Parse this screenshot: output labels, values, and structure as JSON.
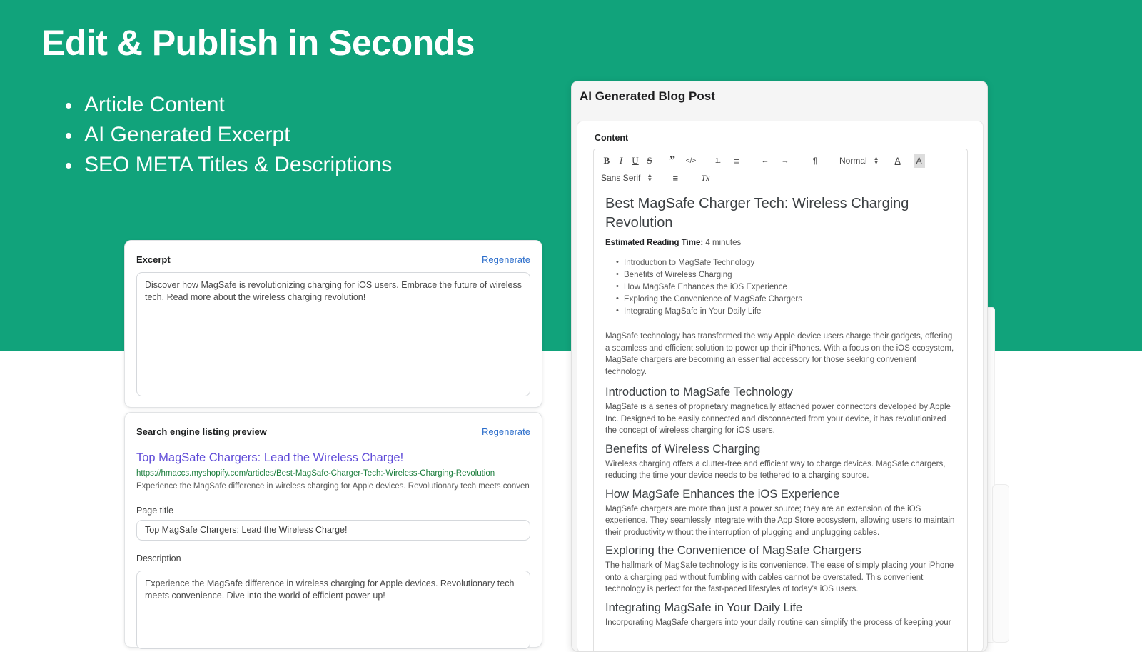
{
  "hero": {
    "title": "Edit & Publish in Seconds",
    "bullets": [
      "Article Content",
      "AI Generated Excerpt",
      "SEO META Titles & Descriptions"
    ],
    "background_color": "#11A37B"
  },
  "excerpt_card": {
    "label": "Excerpt",
    "regenerate_label": "Regenerate",
    "value": "Discover how MagSafe is revolutionizing charging for iOS users. Embrace the future of wireless tech. Read more about the wireless charging revolution!"
  },
  "seo_card": {
    "label": "Search engine listing preview",
    "regenerate_label": "Regenerate",
    "preview": {
      "title": "Top MagSafe Chargers: Lead the Wireless Charge!",
      "url": "https://hmaccs.myshopify.com/articles/Best-MagSafe-Charger-Tech:-Wireless-Charging-Revolution",
      "description": "Experience the MagSafe difference in wireless charging for Apple devices. Revolutionary tech meets convenience...."
    },
    "page_title_label": "Page title",
    "page_title_value": "Top MagSafe Chargers: Lead the Wireless Charge!",
    "description_label": "Description",
    "description_value": "Experience the MagSafe difference in wireless charging for Apple devices. Revolutionary tech meets convenience. Dive into the world of efficient power-up!"
  },
  "post_card": {
    "title": "AI Generated Blog Post",
    "content_label": "Content",
    "toolbar": {
      "bold": "B",
      "italic": "I",
      "underline": "U",
      "strikethrough": "S",
      "blockquote": "”",
      "code": "</>",
      "ordered_list": "1.",
      "bullet_list": "≡",
      "outdent": "←",
      "indent": "→",
      "direction": "¶",
      "heading_select": "Normal",
      "font_select": "Sans Serif",
      "align": "≡",
      "clear_format": "Tx",
      "text_color": "A",
      "background_color": "A"
    },
    "article": {
      "title": "Best MagSafe Charger Tech: Wireless Charging Revolution",
      "reading_time_label": "Estimated Reading Time:",
      "reading_time_value": "4 minutes",
      "toc": [
        "Introduction to MagSafe Technology",
        "Benefits of Wireless Charging",
        "How MagSafe Enhances the iOS Experience",
        "Exploring the Convenience of MagSafe Chargers",
        "Integrating MagSafe in Your Daily Life"
      ],
      "intro": "MagSafe technology has transformed the way Apple device users charge their gadgets, offering a seamless and efficient solution to power up their iPhones. With a focus on the iOS ecosystem, MagSafe chargers are becoming an essential accessory for those seeking convenient technology.",
      "sections": [
        {
          "heading": "Introduction to MagSafe Technology",
          "body": "MagSafe is a series of proprietary magnetically attached power connectors developed by Apple Inc. Designed to be easily connected and disconnected from your device, it has revolutionized the concept of wireless charging for iOS users."
        },
        {
          "heading": "Benefits of Wireless Charging",
          "body": "Wireless charging offers a clutter-free and efficient way to charge devices. MagSafe chargers, reducing the time your device needs to be tethered to a charging source."
        },
        {
          "heading": "How MagSafe Enhances the iOS Experience",
          "body": "MagSafe chargers are more than just a power source; they are an extension of the iOS experience. They seamlessly integrate with the App Store ecosystem, allowing users to maintain their productivity without the interruption of plugging and unplugging cables."
        },
        {
          "heading": "Exploring the Convenience of MagSafe Chargers",
          "body": "The hallmark of MagSafe technology is its convenience. The ease of simply placing your iPhone onto a charging pad without fumbling with cables cannot be overstated. This convenient technology is perfect for the fast-paced lifestyles of today's iOS users."
        },
        {
          "heading": "Integrating MagSafe in Your Daily Life",
          "body": "Incorporating MagSafe chargers into your daily routine can simplify the process of keeping your"
        }
      ]
    }
  }
}
